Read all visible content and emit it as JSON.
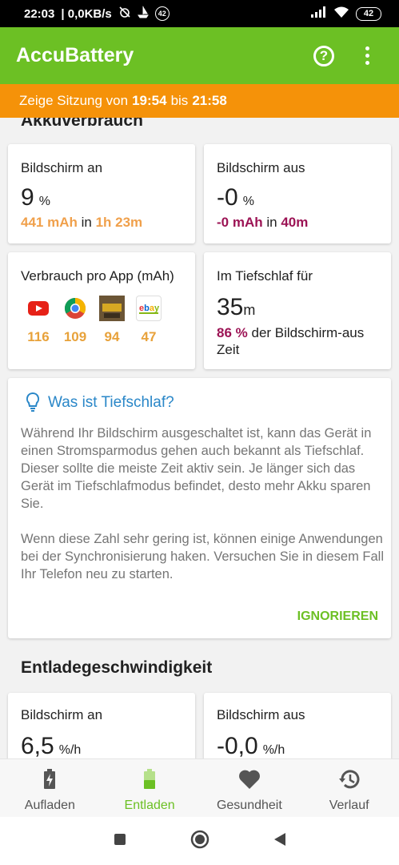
{
  "status_bar": {
    "time": "22:03",
    "speed": "0,0KB/s",
    "badge": "42",
    "battery": "42"
  },
  "app_bar": {
    "title": "AccuBattery",
    "icons": [
      "help-icon",
      "more-vert-icon"
    ]
  },
  "session": {
    "prefix": "Zeige Sitzung von",
    "start": "19:54",
    "mid": "bis",
    "end": "21:58"
  },
  "usage": {
    "title": "Akkuverbrauch",
    "screen_on": {
      "label": "Bildschirm an",
      "value": "9",
      "unit": "%",
      "mah": "441 mAh",
      "in": "in",
      "duration": "1h 23m"
    },
    "screen_off": {
      "label": "Bildschirm aus",
      "value": "-0",
      "unit": "%",
      "mah": "-0 mAh",
      "in": "in",
      "duration": "40m"
    },
    "per_app": {
      "label": "Verbrauch pro App (mAh)",
      "apps": [
        {
          "name": "youtube-icon",
          "value": "116"
        },
        {
          "name": "chrome-icon",
          "value": "109"
        },
        {
          "name": "game-icon",
          "value": "94"
        },
        {
          "name": "ebay-kleinanzeigen-icon",
          "value": "47"
        }
      ]
    },
    "deep_sleep": {
      "label": "Im Tiefschlaf für",
      "value": "35",
      "unit": "m",
      "percent": "86 %",
      "text": "der Bildschirm-aus Zeit"
    }
  },
  "tip": {
    "title": "Was ist Tiefschlaf?",
    "p1": "Während Ihr Bildschirm ausgeschaltet ist, kann das Gerät in einen Stromsparmodus gehen auch bekannt als Tiefschlaf. Dieser sollte die meiste Zeit aktiv sein. Je länger sich das Gerät im Tiefschlafmodus befindet, desto mehr Akku sparen Sie.",
    "p2": "Wenn diese Zahl sehr gering ist, können einige Anwendungen bei der Synchronisierung haken. Versuchen Sie in diesem Fall Ihr Telefon neu zu starten.",
    "action": "IGNORIEREN"
  },
  "discharge": {
    "title": "Entladegeschwindigkeit",
    "screen_on": {
      "label": "Bildschirm an",
      "value": "6,5",
      "unit": "%/h"
    },
    "screen_off": {
      "label": "Bildschirm aus",
      "value": "-0,0",
      "unit": "%/h"
    }
  },
  "bottom_nav": [
    {
      "label": "Aufladen",
      "icon": "battery-charging-icon",
      "active": false
    },
    {
      "label": "Entladen",
      "icon": "battery-icon",
      "active": true
    },
    {
      "label": "Gesundheit",
      "icon": "heart-icon",
      "active": false
    },
    {
      "label": "Verlauf",
      "icon": "history-icon",
      "active": false
    }
  ],
  "colors": {
    "green": "#6cc024",
    "orange_banner": "#f59209",
    "orange_text": "#f0a04b",
    "purple": "#9c1455",
    "blue": "#2a87c8"
  }
}
